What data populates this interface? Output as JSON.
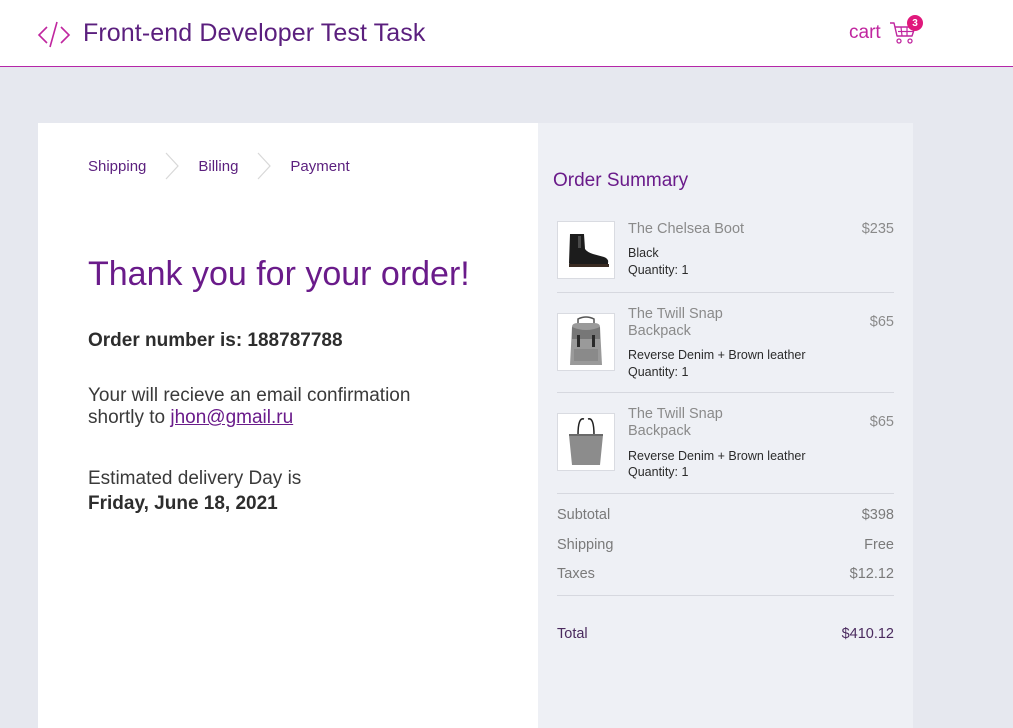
{
  "header": {
    "title": "Front-end Developer Test Task",
    "logo_icon": "code-brackets-icon",
    "cart_label": "cart",
    "cart_count": "3",
    "cart_icon": "shopping-cart-icon",
    "accent_color": "#c0269f"
  },
  "breadcrumb": {
    "items": [
      {
        "label": "Shipping"
      },
      {
        "label": "Billing"
      },
      {
        "label": "Payment"
      }
    ],
    "separator_icon": "chevron-right-icon"
  },
  "confirmation": {
    "title": "Thank you for your order!",
    "order_number_label": "Order number is: 188787788",
    "email_text": "Your will recieve an email confirmation shortly to",
    "email": "jhon@gmail.ru",
    "delivery_label": "Estimated delivery Day is",
    "delivery_date": "Friday, June 18, 2021"
  },
  "summary": {
    "title": "Order Summary",
    "items": [
      {
        "name": "The Chelsea Boot",
        "price": "$235",
        "variant": "Black",
        "quantity": "Quantity: 1",
        "image": "boot-icon"
      },
      {
        "name": "The Twill Snap Backpack",
        "price": "$65",
        "variant": "Reverse Denim + Brown leather",
        "quantity": "Quantity: 1",
        "image": "backpack-icon"
      },
      {
        "name": "The Twill Snap Backpack",
        "price": "$65",
        "variant": "Reverse Denim + Brown leather",
        "quantity": "Quantity: 1",
        "image": "tote-bag-icon"
      }
    ],
    "subtotal_label": "Subtotal",
    "subtotal_value": "$398",
    "shipping_label": "Shipping",
    "shipping_value": "Free",
    "taxes_label": "Taxes",
    "taxes_value": "$12.12",
    "total_label": "Total",
    "total_value": "$410.12"
  }
}
